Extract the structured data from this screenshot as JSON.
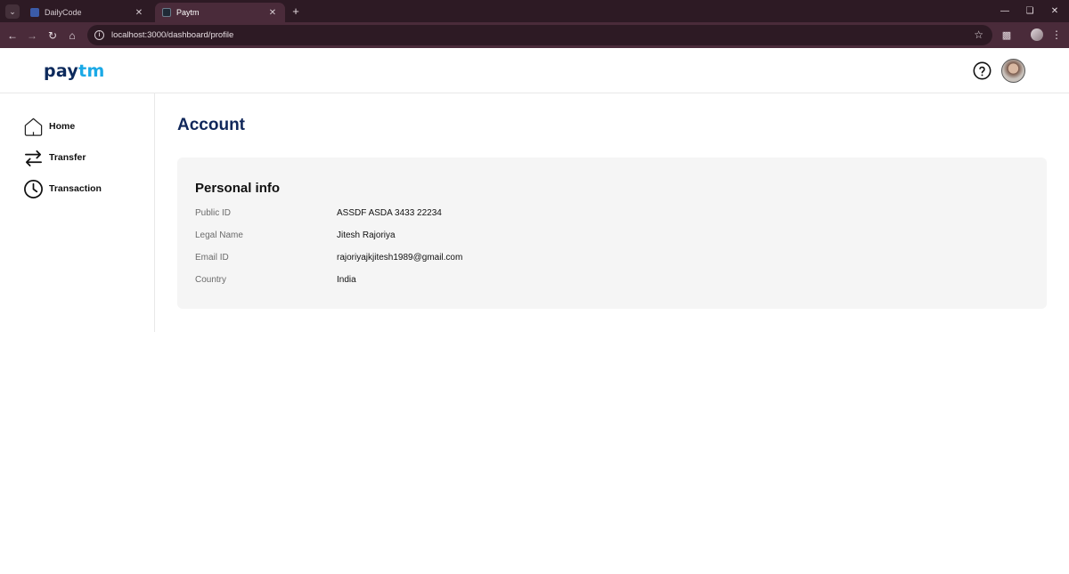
{
  "browser": {
    "tabs": [
      {
        "title": "DailyCode",
        "active": false
      },
      {
        "title": "Paytm",
        "active": true
      }
    ],
    "url": "localhost:3000/dashboard/profile"
  },
  "header": {
    "logo_pay": "pay",
    "logo_tm": "tm"
  },
  "sidebar": {
    "items": [
      {
        "label": "Home",
        "icon": "home-icon"
      },
      {
        "label": "Transfer",
        "icon": "transfer-icon"
      },
      {
        "label": "Transaction",
        "icon": "clock-icon"
      }
    ]
  },
  "main": {
    "title": "Account",
    "personal_info": {
      "title": "Personal info",
      "rows": [
        {
          "label": "Public ID",
          "value": "ASSDF ASDA 3433 22234"
        },
        {
          "label": "Legal Name",
          "value": "Jitesh Rajoriya"
        },
        {
          "label": "Email ID",
          "value": "rajoriyajkjitesh1989@gmail.com"
        },
        {
          "label": "Country",
          "value": "India"
        }
      ]
    }
  },
  "colors": {
    "brand_dark": "#0d2a5c",
    "brand_light": "#1aa9e6",
    "chrome": "#4a2b3a",
    "card_bg": "#f5f5f5"
  }
}
